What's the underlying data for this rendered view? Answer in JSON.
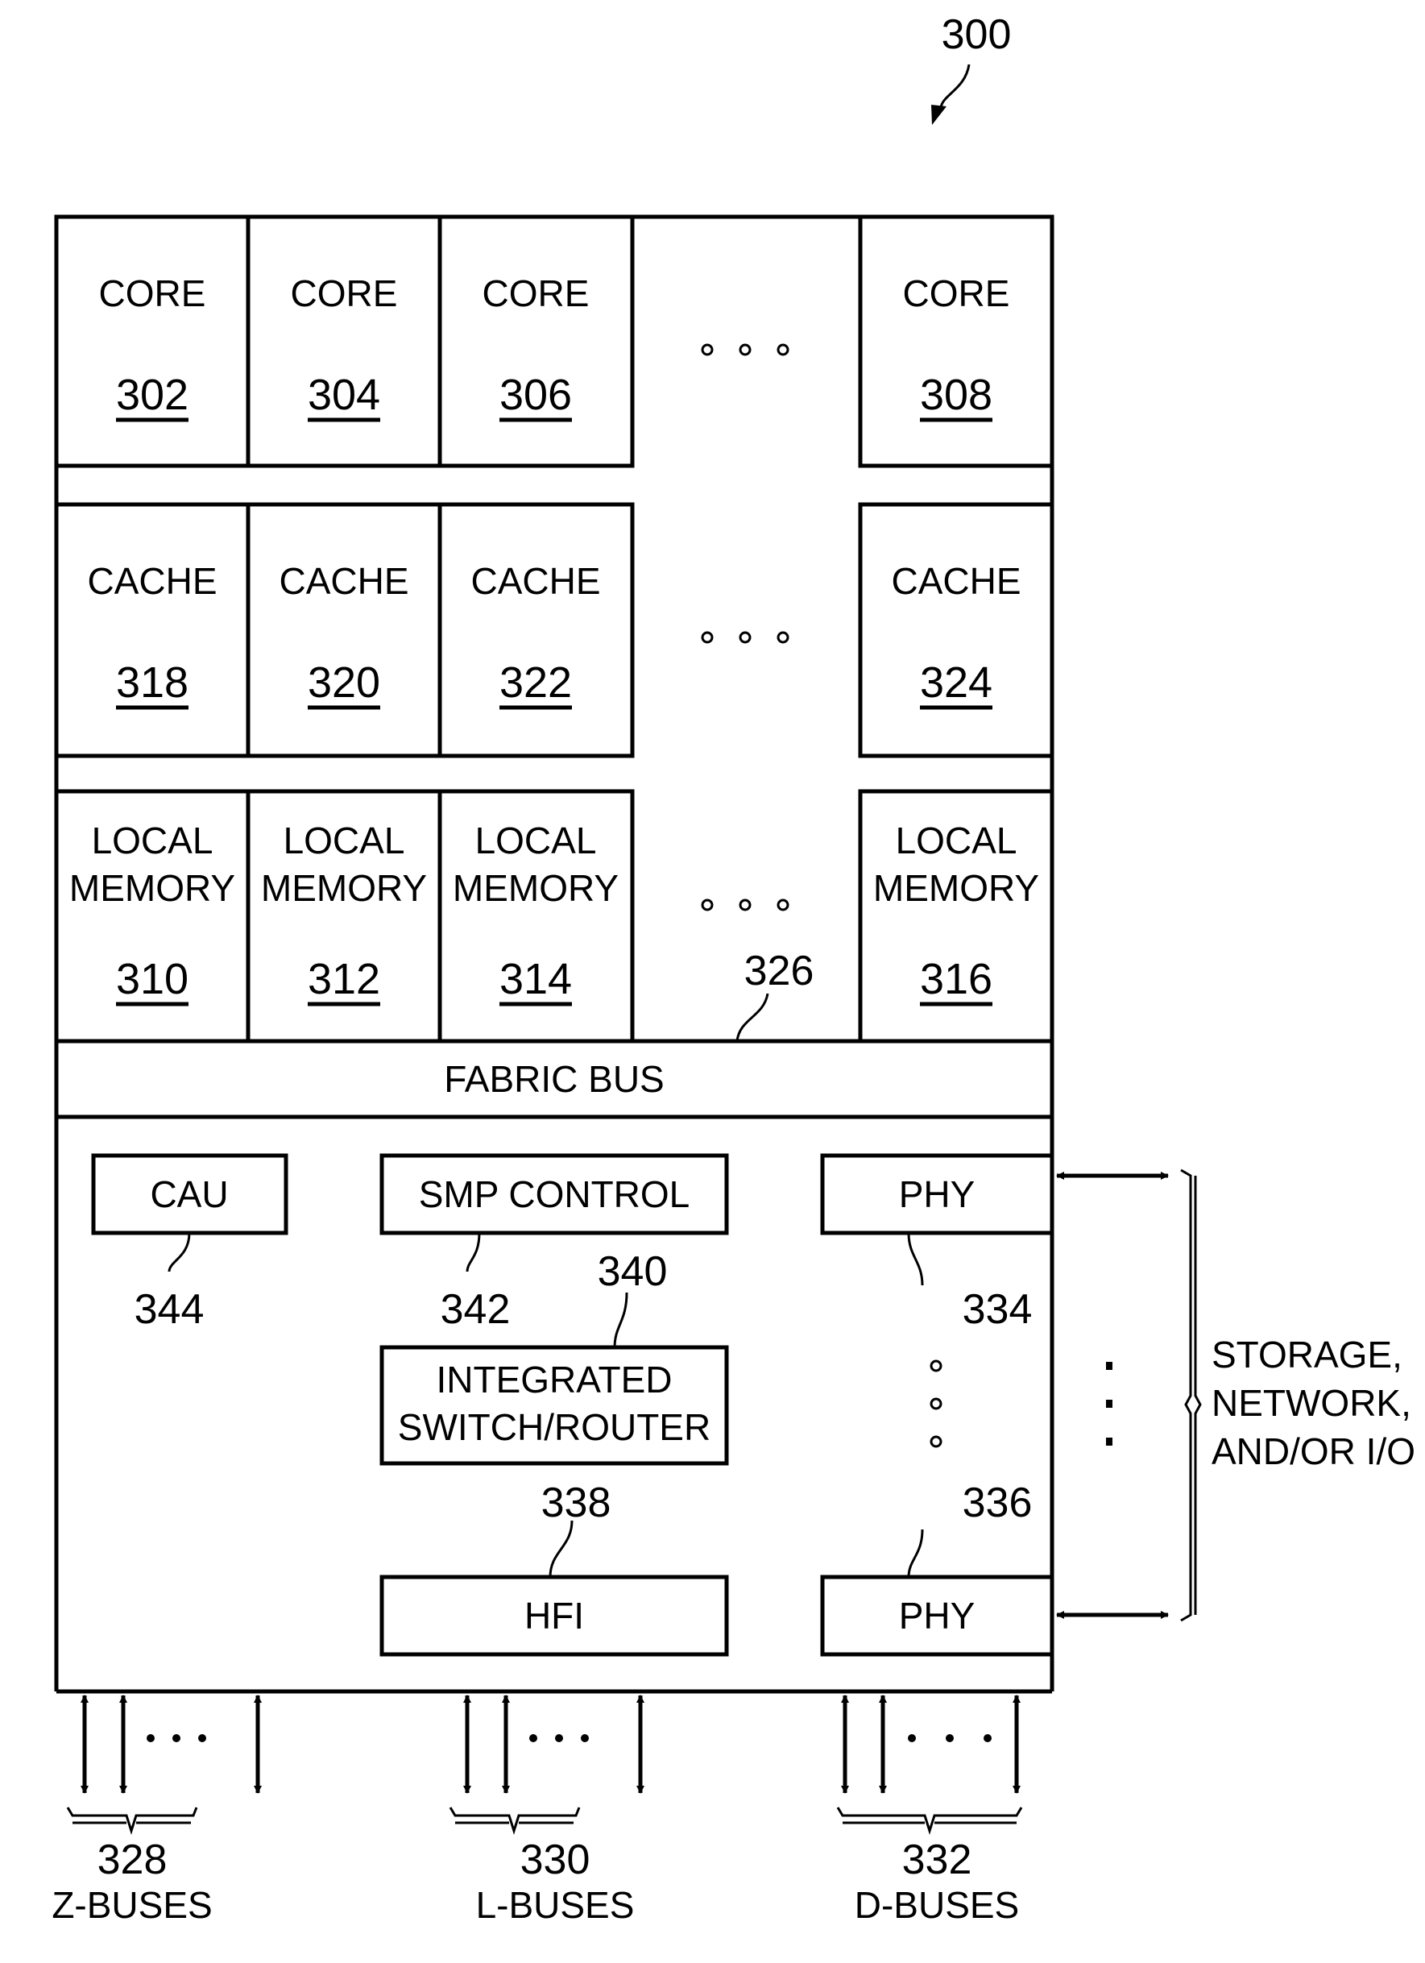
{
  "figure": {
    "ref": "300",
    "colors": {
      "line": "#000000",
      "background": "#ffffff"
    }
  },
  "cores": [
    {
      "label": "CORE",
      "ref": "302"
    },
    {
      "label": "CORE",
      "ref": "304"
    },
    {
      "label": "CORE",
      "ref": "306"
    },
    {
      "label": "CORE",
      "ref": "308"
    }
  ],
  "caches": [
    {
      "label": "CACHE",
      "ref": "318"
    },
    {
      "label": "CACHE",
      "ref": "320"
    },
    {
      "label": "CACHE",
      "ref": "322"
    },
    {
      "label": "CACHE",
      "ref": "324"
    }
  ],
  "memories": [
    {
      "line1": "LOCAL",
      "line2": "MEMORY",
      "ref": "310"
    },
    {
      "line1": "LOCAL",
      "line2": "MEMORY",
      "ref": "312"
    },
    {
      "line1": "LOCAL",
      "line2": "MEMORY",
      "ref": "314"
    },
    {
      "line1": "LOCAL",
      "line2": "MEMORY",
      "ref": "316"
    }
  ],
  "fabric_bus": {
    "label": "FABRIC BUS",
    "ref": "326"
  },
  "components": {
    "cau": {
      "label": "CAU",
      "ref": "344"
    },
    "smp": {
      "label": "SMP CONTROL",
      "ref": "342"
    },
    "switch": {
      "line1": "INTEGRATED",
      "line2": "SWITCH/ROUTER",
      "ref": "340"
    },
    "hfi": {
      "label": "HFI",
      "ref": "338"
    },
    "phy_top": {
      "label": "PHY",
      "ref": "334"
    },
    "phy_bottom": {
      "label": "PHY",
      "ref": "336"
    }
  },
  "external": {
    "line1": "STORAGE,",
    "line2": "NETWORK,",
    "line3": "AND/OR I/O"
  },
  "buses": [
    {
      "ref": "328",
      "label": "Z-BUSES"
    },
    {
      "ref": "330",
      "label": "L-BUSES"
    },
    {
      "ref": "332",
      "label": "D-BUSES"
    }
  ]
}
